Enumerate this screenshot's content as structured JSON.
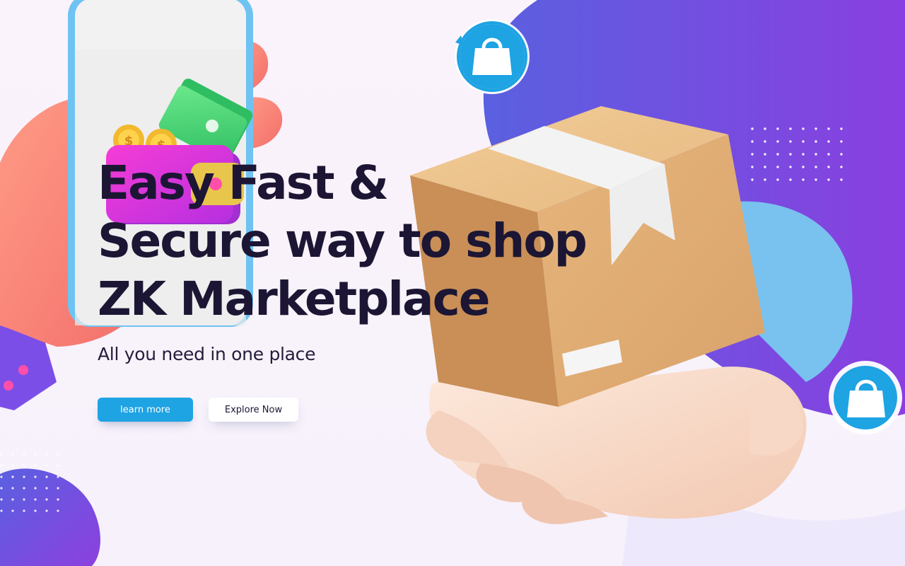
{
  "hero": {
    "headline_lines": [
      "Easy Fast &",
      "Secure way to shop",
      "ZK Marketplace"
    ],
    "subtitle": "All you need in one place",
    "primary_button_label": "learn more",
    "secondary_button_label": "Explore Now"
  },
  "colors": {
    "primary_button": "#1ea3e3",
    "headline_text": "#1c1634",
    "blob_gradient_start": "#5b5ee0",
    "blob_gradient_end": "#8a3fe0",
    "bag_icon_blue": "#1ea3e3",
    "background": "#fbf3fb"
  },
  "icons": [
    "shopping-bag-refresh-icon",
    "shopping-bag-icon",
    "dollar-coin-icon",
    "cash-bills-icon",
    "wallet-icon",
    "phone-illustration",
    "package-box-illustration",
    "hand-illustration"
  ]
}
